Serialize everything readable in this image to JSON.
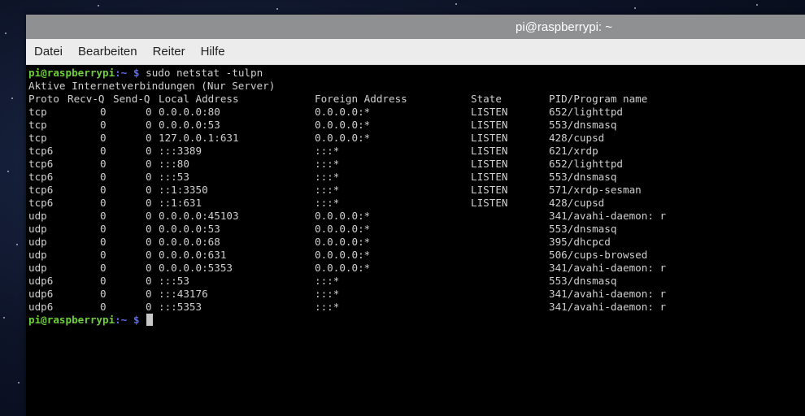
{
  "window": {
    "title": "pi@raspberrypi: ~"
  },
  "menubar": {
    "items": [
      "Datei",
      "Bearbeiten",
      "Reiter",
      "Hilfe"
    ]
  },
  "terminal": {
    "prompt_user": "pi@raspberrypi",
    "prompt_path": ":~",
    "prompt_symbol": "$",
    "command": "sudo netstat -tulpn",
    "info_line": "Aktive Internetverbindungen (Nur Server)",
    "headers": {
      "proto": "Proto",
      "recv": "Recv-Q",
      "send": "Send-Q",
      "local": "Local Address",
      "foreign": "Foreign Address",
      "state": "State",
      "pid": "PID/Program name"
    },
    "rows": [
      {
        "proto": "tcp",
        "recv": "0",
        "send": "0",
        "local": "0.0.0.0:80",
        "foreign": "0.0.0.0:*",
        "state": "LISTEN",
        "pid": "652/lighttpd"
      },
      {
        "proto": "tcp",
        "recv": "0",
        "send": "0",
        "local": "0.0.0.0:53",
        "foreign": "0.0.0.0:*",
        "state": "LISTEN",
        "pid": "553/dnsmasq"
      },
      {
        "proto": "tcp",
        "recv": "0",
        "send": "0",
        "local": "127.0.0.1:631",
        "foreign": "0.0.0.0:*",
        "state": "LISTEN",
        "pid": "428/cupsd"
      },
      {
        "proto": "tcp6",
        "recv": "0",
        "send": "0",
        "local": ":::3389",
        "foreign": ":::*",
        "state": "LISTEN",
        "pid": "621/xrdp"
      },
      {
        "proto": "tcp6",
        "recv": "0",
        "send": "0",
        "local": ":::80",
        "foreign": ":::*",
        "state": "LISTEN",
        "pid": "652/lighttpd"
      },
      {
        "proto": "tcp6",
        "recv": "0",
        "send": "0",
        "local": ":::53",
        "foreign": ":::*",
        "state": "LISTEN",
        "pid": "553/dnsmasq"
      },
      {
        "proto": "tcp6",
        "recv": "0",
        "send": "0",
        "local": "::1:3350",
        "foreign": ":::*",
        "state": "LISTEN",
        "pid": "571/xrdp-sesman"
      },
      {
        "proto": "tcp6",
        "recv": "0",
        "send": "0",
        "local": "::1:631",
        "foreign": ":::*",
        "state": "LISTEN",
        "pid": "428/cupsd"
      },
      {
        "proto": "udp",
        "recv": "0",
        "send": "0",
        "local": "0.0.0.0:45103",
        "foreign": "0.0.0.0:*",
        "state": "",
        "pid": "341/avahi-daemon: r"
      },
      {
        "proto": "udp",
        "recv": "0",
        "send": "0",
        "local": "0.0.0.0:53",
        "foreign": "0.0.0.0:*",
        "state": "",
        "pid": "553/dnsmasq"
      },
      {
        "proto": "udp",
        "recv": "0",
        "send": "0",
        "local": "0.0.0.0:68",
        "foreign": "0.0.0.0:*",
        "state": "",
        "pid": "395/dhcpcd"
      },
      {
        "proto": "udp",
        "recv": "0",
        "send": "0",
        "local": "0.0.0.0:631",
        "foreign": "0.0.0.0:*",
        "state": "",
        "pid": "506/cups-browsed"
      },
      {
        "proto": "udp",
        "recv": "0",
        "send": "0",
        "local": "0.0.0.0:5353",
        "foreign": "0.0.0.0:*",
        "state": "",
        "pid": "341/avahi-daemon: r"
      },
      {
        "proto": "udp6",
        "recv": "0",
        "send": "0",
        "local": ":::53",
        "foreign": ":::*",
        "state": "",
        "pid": "553/dnsmasq"
      },
      {
        "proto": "udp6",
        "recv": "0",
        "send": "0",
        "local": ":::43176",
        "foreign": ":::*",
        "state": "",
        "pid": "341/avahi-daemon: r"
      },
      {
        "proto": "udp6",
        "recv": "0",
        "send": "0",
        "local": ":::5353",
        "foreign": ":::*",
        "state": "",
        "pid": "341/avahi-daemon: r"
      }
    ]
  },
  "colors": {
    "prompt_user": "#6ccf3a",
    "prompt_path": "#5a6cf5",
    "terminal_bg": "#000000",
    "terminal_fg": "#cfcfcf",
    "titlebar_bg": "#8e9091",
    "menubar_bg": "#ececec"
  }
}
